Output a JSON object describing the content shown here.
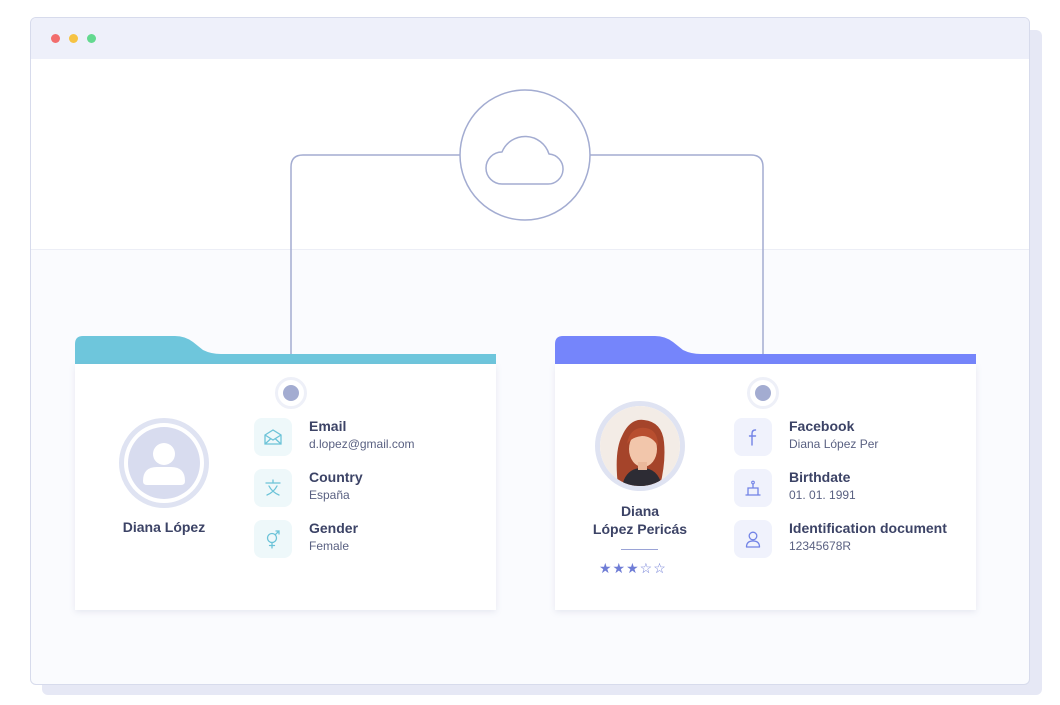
{
  "window": {
    "controls": [
      "close",
      "minimize",
      "maximize"
    ]
  },
  "cloud": {
    "icon": "cloud-icon"
  },
  "colors": {
    "teal_tab": "#6ec6dc",
    "blue_tab": "#7585fb",
    "connector": "#a3acd1"
  },
  "left_card": {
    "name": "Diana López",
    "avatar": "user-placeholder-icon",
    "fields": [
      {
        "icon": "mail-icon",
        "label": "Email",
        "value": "d.lopez@gmail.com"
      },
      {
        "icon": "language-icon",
        "label": "Country",
        "value": "España"
      },
      {
        "icon": "gender-icon",
        "label": "Gender",
        "value": "Female"
      }
    ]
  },
  "right_card": {
    "name_line1": "Diana",
    "name_line2": "López Pericás",
    "avatar": "profile-photo",
    "rating": {
      "value": 3,
      "max": 5
    },
    "stars": "★★★☆☆",
    "fields": [
      {
        "icon": "facebook-icon",
        "label": "Facebook",
        "value": "Diana López Per"
      },
      {
        "icon": "birthday-cake-icon",
        "label": "Birthdate",
        "value": "01. 01. 1991"
      },
      {
        "icon": "user-outline-icon",
        "label": "Identification document",
        "value": "12345678R"
      }
    ]
  }
}
